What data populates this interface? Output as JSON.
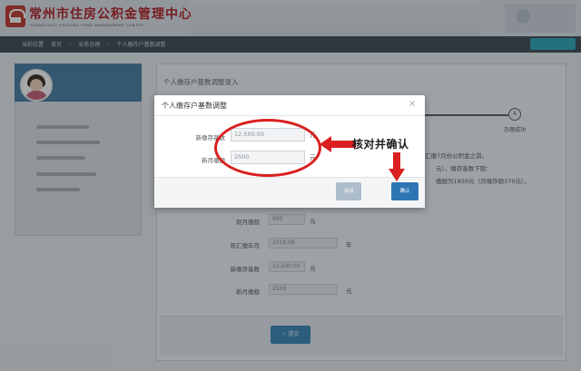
{
  "header": {
    "org_name": "常州市住房公积金管理中心",
    "org_name_en": "CHANGZHOU HOUSING FUND MANAGEMENT CENTER"
  },
  "breadcrumb": [
    "当前位置",
    "首页",
    "业务办理",
    "个人缴存户基数调整"
  ],
  "main": {
    "title": "个人缴存户基数调整录入",
    "step_number": "4",
    "step_label": "办理成功",
    "notice_1": "汇缴7月份公积金之前。",
    "notice_2": "元），缴存基数下限：",
    "notice_3": "缴额为1850元（月缴存额370元）。",
    "fields": [
      {
        "label": "现月缴额",
        "value": "800",
        "unit": "元"
      },
      {
        "label": "现汇缴年月",
        "value": "2018.06",
        "unit": "年"
      },
      {
        "label": "新缴存基数",
        "value": "12,500.00",
        "unit": "元"
      },
      {
        "label": "新月缴额",
        "value": "2500",
        "unit": "元"
      }
    ],
    "submit_label": "提交"
  },
  "modal": {
    "title": "个人缴存户基数调整",
    "close_glyph": "×",
    "fields": [
      {
        "label": "新缴存基数",
        "value": "12,500.00",
        "unit": "元"
      },
      {
        "label": "新月缴额",
        "value": "2500",
        "unit": "元"
      }
    ],
    "cancel_label": "关闭",
    "confirm_label": "确认"
  },
  "annotation": {
    "text": "核对并确认",
    "color": "#d9201f"
  },
  "colors": {
    "brand_red": "#b21f24",
    "primary_blue": "#2d76b3",
    "nav_dark": "#3f4b55"
  }
}
